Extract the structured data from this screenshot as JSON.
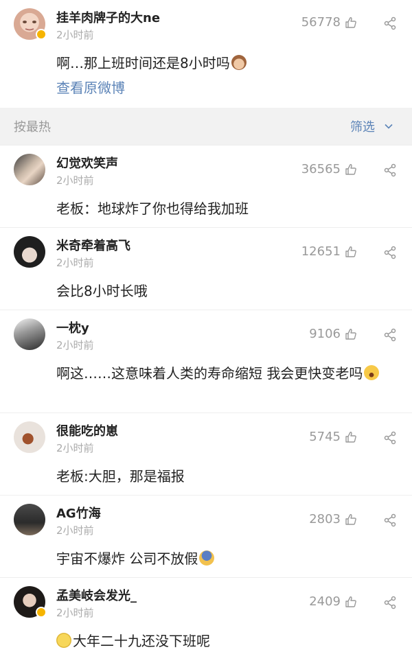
{
  "post": {
    "author": "挂羊肉牌子的大ne",
    "time": "2小时前",
    "text": "啊…那上班时间还是8小时吗",
    "likes": "56778",
    "view_original": "查看原微博"
  },
  "filter": {
    "sort_label": "按最热",
    "filter_label": "筛选"
  },
  "comments": [
    {
      "name": "幻觉欢笑声",
      "time": "2小时前",
      "text": "老板：地球炸了你也得给我加班",
      "likes": "36565"
    },
    {
      "name": "米奇牵着高飞",
      "time": "2小时前",
      "text": "会比8小时长哦",
      "likes": "12651"
    },
    {
      "name": "一枕y",
      "time": "2小时前",
      "text": "啊这……这意味着人类的寿命缩短 我会更快变老吗",
      "likes": "9106"
    },
    {
      "name": "很能吃的崽",
      "time": "2小时前",
      "text": "老板:大胆，那是福报",
      "likes": "5745"
    },
    {
      "name": "AG竹海",
      "time": "2小时前",
      "text": "宇宙不爆炸 公司不放假",
      "likes": "2803"
    },
    {
      "name": "孟美岐会发光_",
      "time": "2小时前",
      "text": "大年二十九还没下班呢",
      "likes": "2409"
    }
  ],
  "icons": {
    "like": "thumbs-up-icon",
    "share": "share-icon",
    "chevron": "chevron-down-icon",
    "verified": "verified-badge-icon"
  },
  "colors": {
    "link": "#5b83b7",
    "muted": "#999999",
    "verified": "#f6b400"
  }
}
